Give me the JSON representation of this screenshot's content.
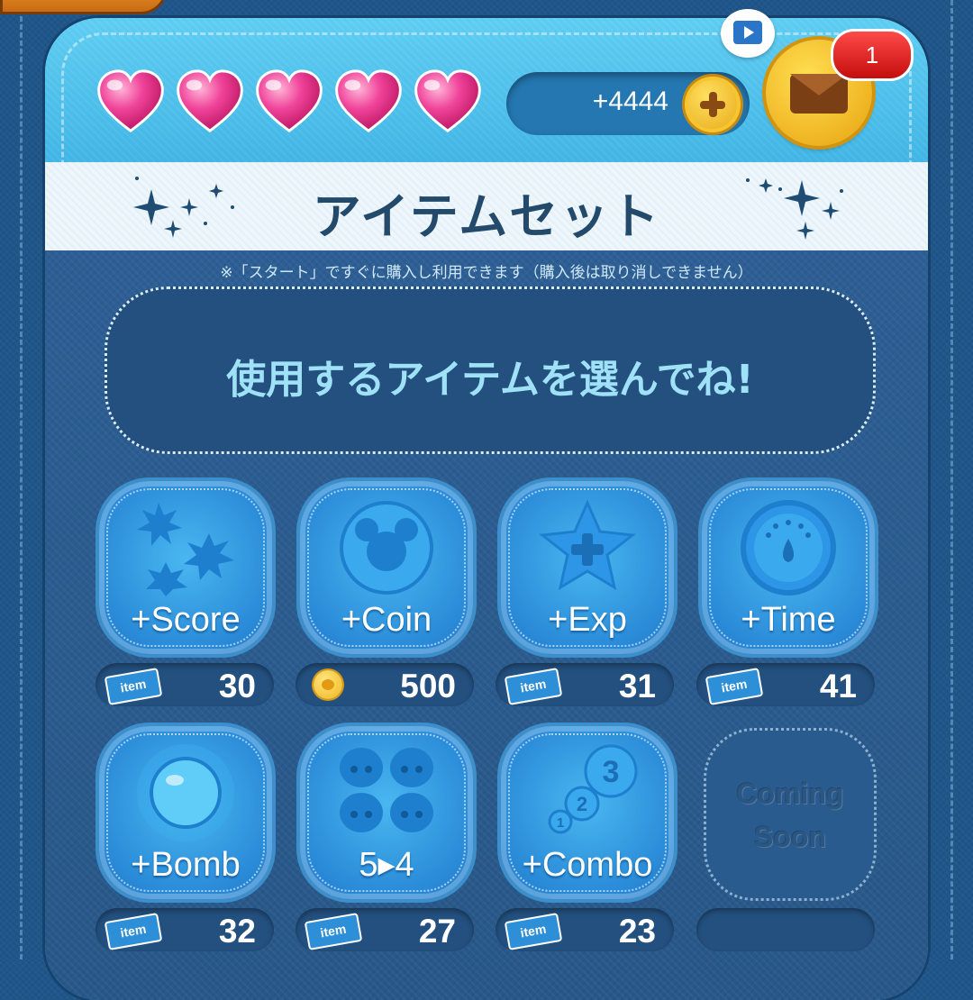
{
  "header": {
    "lives": 5,
    "coin_delta": "+4444",
    "mail_badge": "1"
  },
  "title": "アイテムセット",
  "note": "※「スタート」ですぐに購入し利用できます（購入後は取り消しできません）",
  "prompt": "使用するアイテムを選んでね!",
  "items": [
    {
      "label": "+Score",
      "price": "30",
      "currency": "item-ticket"
    },
    {
      "label": "+Coin",
      "price": "500",
      "currency": "coin"
    },
    {
      "label": "+Exp",
      "price": "31",
      "currency": "item-ticket"
    },
    {
      "label": "+Time",
      "price": "41",
      "currency": "item-ticket"
    },
    {
      "label": "+Bomb",
      "price": "32",
      "currency": "item-ticket"
    },
    {
      "label": "5▸4",
      "price": "27",
      "currency": "item-ticket"
    },
    {
      "label": "+Combo",
      "price": "23",
      "currency": "item-ticket"
    }
  ],
  "coming_soon": [
    "Coming",
    "Soon"
  ],
  "ticket_text": "item",
  "colors": {
    "panel_cyan": "#2ea6dd",
    "panel_blue": "#2a66a0",
    "item_blue": "#2a8bd8",
    "heart_pink": "#f0449a",
    "gold": "#f2b51e",
    "badge_red": "#d61515"
  }
}
